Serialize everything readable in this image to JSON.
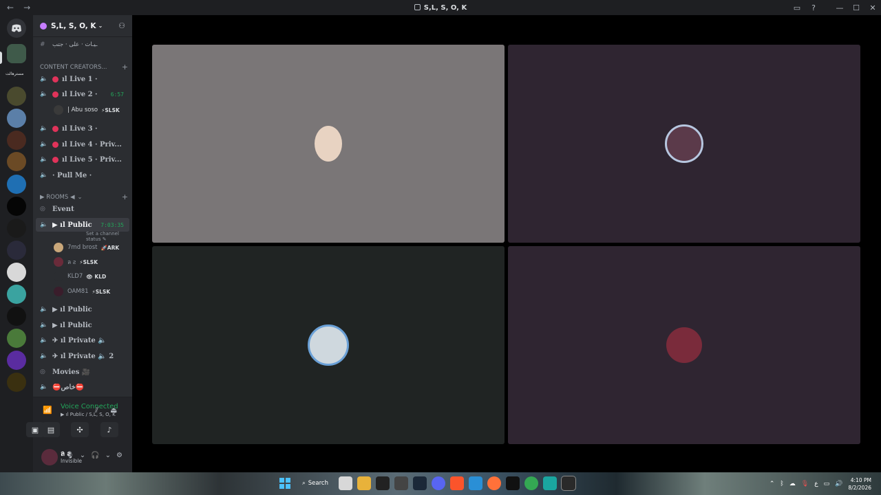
{
  "window": {
    "title": "S,L, S, O, K",
    "back_icon": "arrow-left-icon",
    "forward_icon": "arrow-right-icon",
    "inbox_icon": "inbox-icon",
    "help_icon": "help-icon",
    "minimize": "—",
    "maximize": "☐",
    "close": "✕"
  },
  "server": {
    "name": "S,L, S, O, K",
    "server_label": "مسترهالت"
  },
  "channels": {
    "top_text_channel": "ـيـات · على · جتب",
    "category_1": "CONTENT CREATORS...",
    "live": [
      {
        "name": "ıl Live 1 ·",
        "time": ""
      },
      {
        "name": "ıl Live 2 ·",
        "time": "6:57"
      },
      {
        "name": "ıl Live 3 ·",
        "time": ""
      },
      {
        "name": "ıl Live 4 · Priv...",
        "time": ""
      },
      {
        "name": "ıl Live 5 · Priv...",
        "time": ""
      }
    ],
    "live2_member": {
      "name": "| Abu soso",
      "tag": "⚡SLSK"
    },
    "pull_me": "· Pull Me ·",
    "category_2": "▶ ROOMS ◀",
    "event": "Event",
    "active_channel": {
      "name": "▶ ıl Public",
      "time": "7:03:35",
      "status_hint": "Set a channel status ✎"
    },
    "members": [
      {
        "name": "7md brost",
        "tag": "🚀ARK",
        "color": "#c9a77a"
      },
      {
        "name": "ล ƨ",
        "tag": "⚡SLSK",
        "color": "#6a2b3a"
      },
      {
        "name": "KLD7",
        "tag": "👁 KLD",
        "color": "#2b2d31"
      },
      {
        "name": "OAM81",
        "tag": "⚡SLSK",
        "color": "#3a1d2b"
      }
    ],
    "rest": [
      {
        "name": "▶ ıl Public"
      },
      {
        "name": "▶ ıl Public"
      },
      {
        "name": "✈ ıl Private 🔈"
      },
      {
        "name": "✈ ıl Private 🔈 2"
      },
      {
        "name": "Movies 🎥"
      },
      {
        "name": "⛔خاص⛔"
      }
    ]
  },
  "voice": {
    "status": "Voice Connected",
    "location": "▶ ıl Public / S,L, S, O, K"
  },
  "user": {
    "name": "ล ƨ",
    "status": "Invisible"
  },
  "tiles": [
    {
      "name": "tile-1",
      "bg": "#7a7677",
      "avatar_color": "#e8d3c2"
    },
    {
      "name": "tile-2",
      "bg": "#2f2531",
      "avatar_color": "#5b3a4a"
    },
    {
      "name": "tile-3",
      "bg": "#202423",
      "avatar_color": "#cfd8de"
    },
    {
      "name": "tile-4",
      "bg": "#2f2531",
      "avatar_color": "#7a2b3b"
    }
  ],
  "taskbar": {
    "search_label": "Search",
    "time": "4:10 PM",
    "date": "8/2/2026",
    "lang": "ع"
  }
}
